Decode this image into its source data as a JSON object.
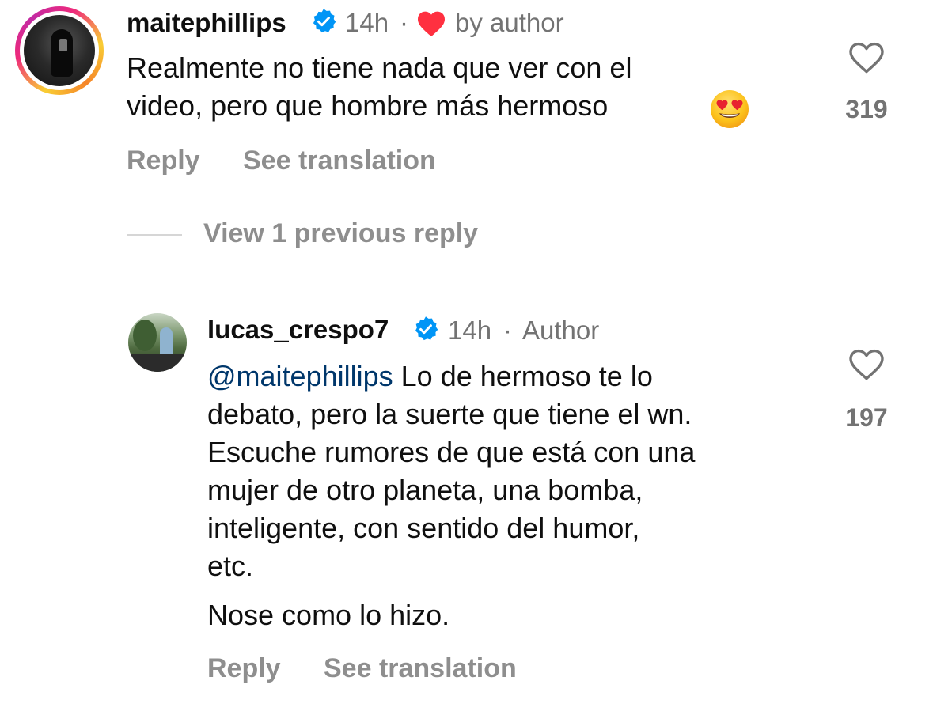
{
  "comments": [
    {
      "username": "maitephillips",
      "time": "14h",
      "separator": "·",
      "liked_by": "by author",
      "body_lines": [
        "Realmente no tiene nada que ver con el",
        "video, pero que hombre más hermoso"
      ],
      "emoji": "heart-eyes",
      "likes": "319",
      "reply_label": "Reply",
      "translate_label": "See translation"
    },
    {
      "username": "lucas_crespo7",
      "time": "14h",
      "separator": "·",
      "author_badge": "Author",
      "mention": "@maitephillips",
      "body_lines": [
        " Lo de hermoso te lo",
        "debato, pero la suerte que tiene el wn.",
        "Escuche rumores de que está con una",
        "mujer de otro planeta, una bomba,",
        "inteligente, con sentido del humor,",
        "etc."
      ],
      "body_paragraph_2": "Nose como lo hizo.",
      "likes": "197",
      "reply_label": "Reply",
      "translate_label": "See translation"
    }
  ],
  "view_replies_label": "View 1 previous reply",
  "colors": {
    "text": "#0f0f0f",
    "meta": "#737373",
    "action": "#8e8e8e",
    "verified": "#0095f6",
    "heart": "#ff3040",
    "mention": "#00376b"
  },
  "icons": [
    "verified-badge-icon",
    "red-heart-icon",
    "heart-outline-icon",
    "heart-eyes-emoji"
  ]
}
